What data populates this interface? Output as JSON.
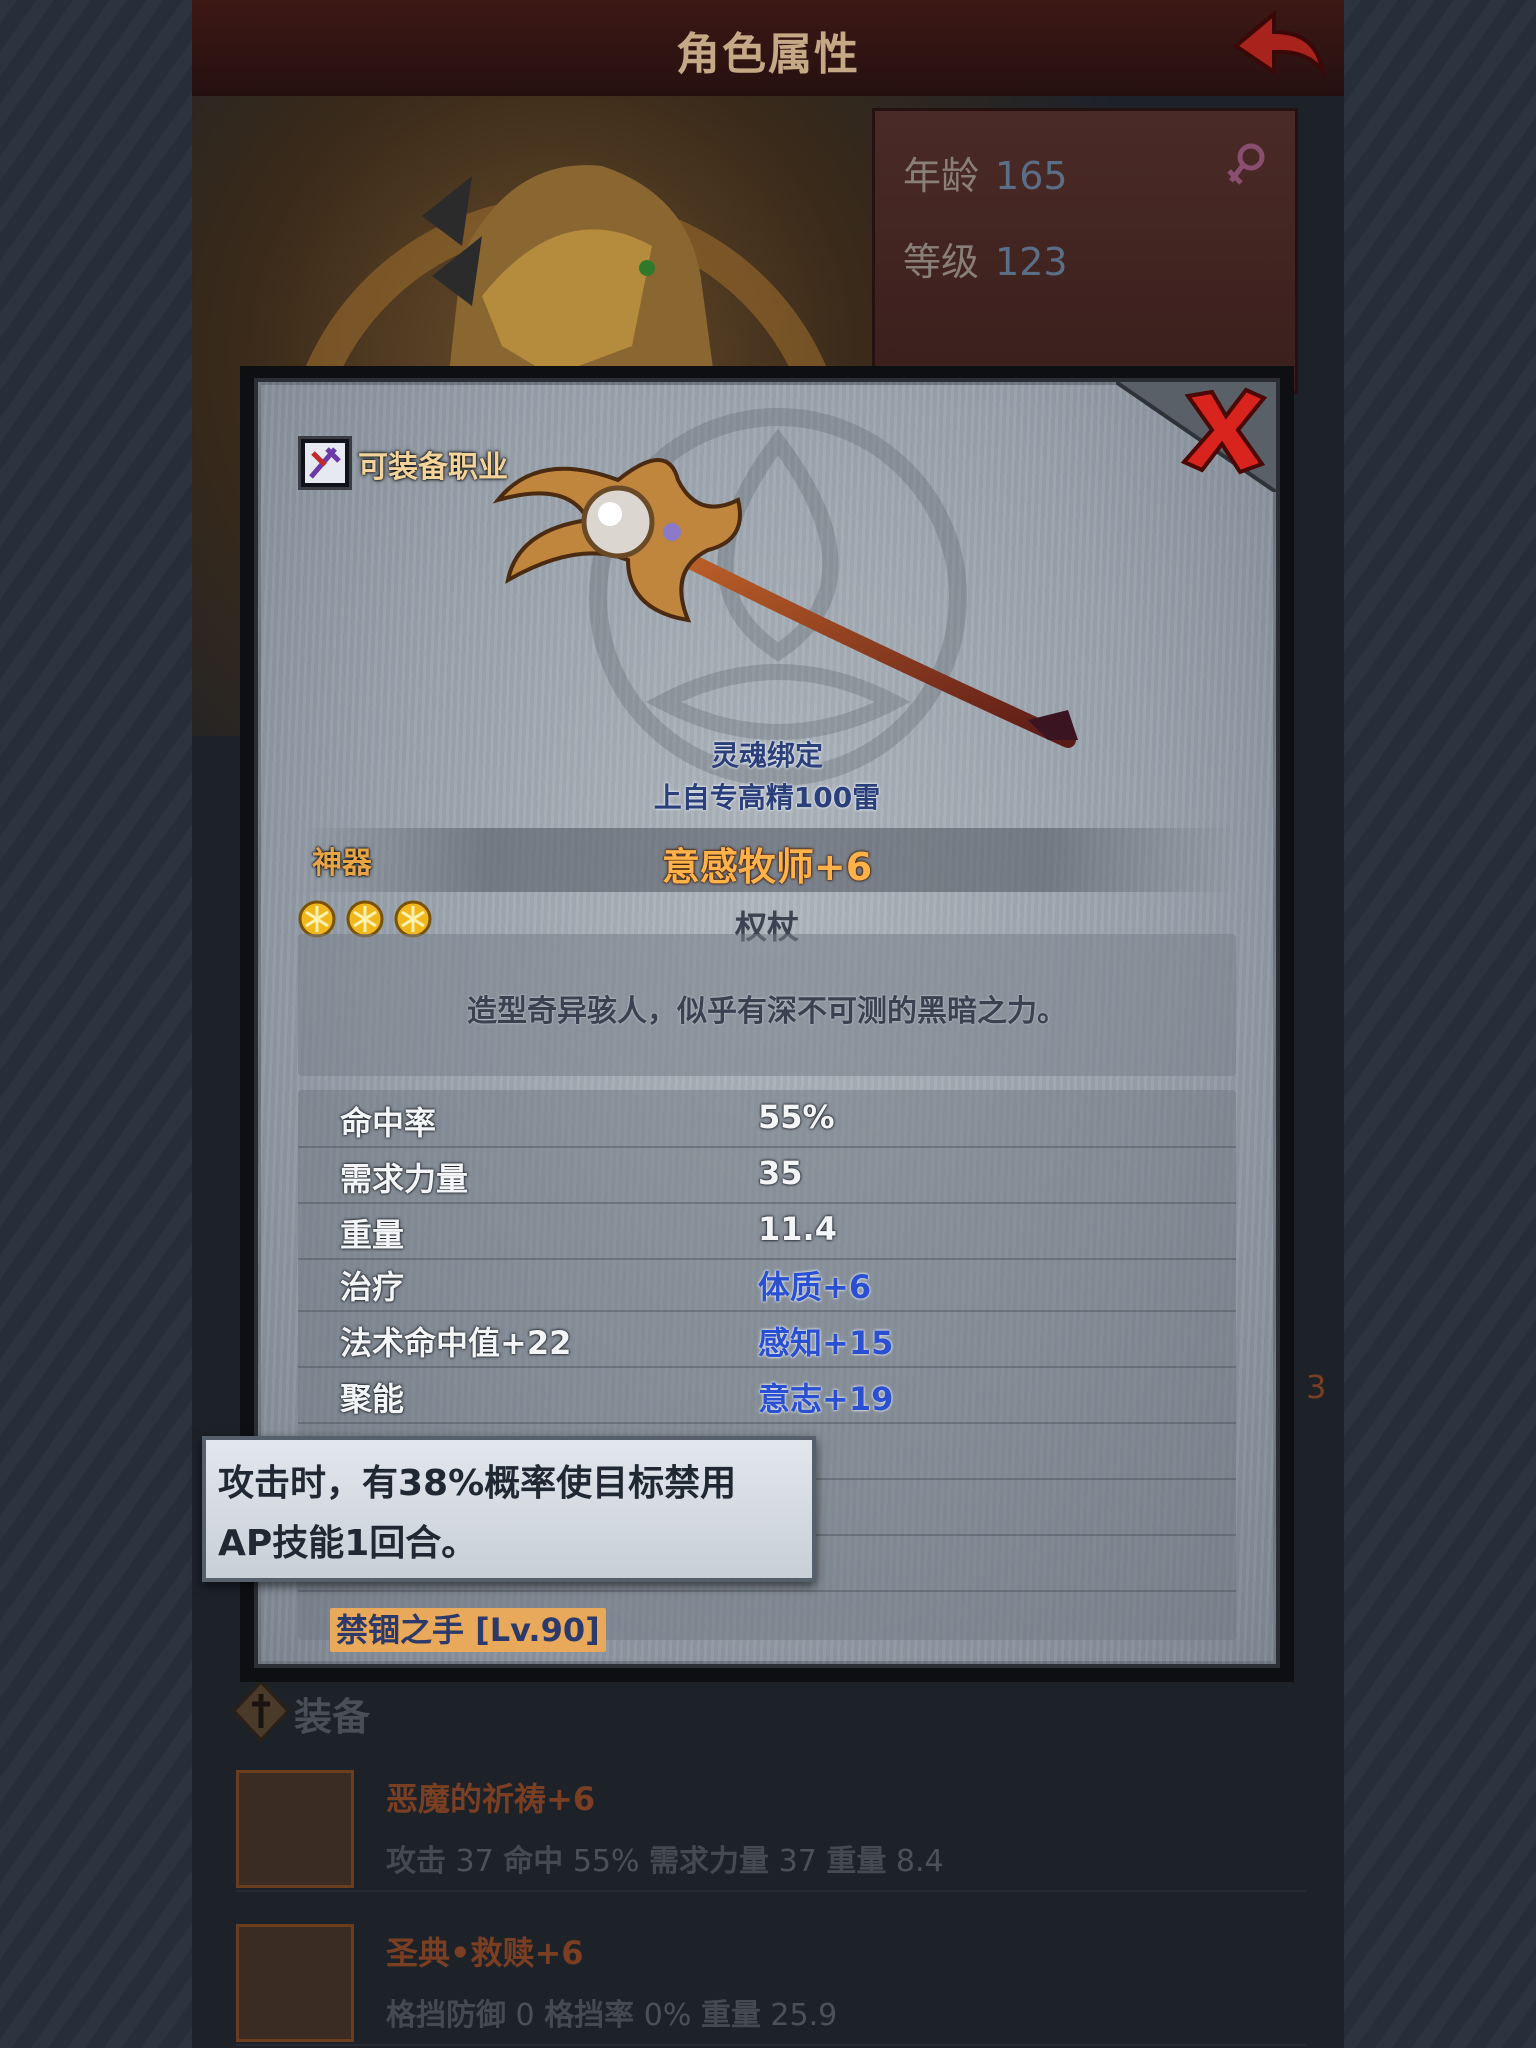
{
  "header": {
    "title": "角色属性"
  },
  "profile": {
    "age_label": "年龄",
    "age_value": "165",
    "level_label": "等级",
    "level_value": "123"
  },
  "equipment_section": {
    "title": "装备",
    "items": [
      {
        "name": "恶魔的祈祷+6",
        "stats": [
          {
            "k": "攻击",
            "v": "37"
          },
          {
            "k": "命中",
            "v": "55%"
          },
          {
            "k": "需求力量",
            "v": "37"
          },
          {
            "k": "重量",
            "v": "8.4"
          }
        ]
      },
      {
        "name": "圣典•救赎+6",
        "stats": [
          {
            "k": "格挡防御",
            "v": "0"
          },
          {
            "k": "格挡率",
            "v": "0%"
          },
          {
            "k": "重量",
            "v": "25.9"
          }
        ]
      }
    ]
  },
  "side_number": "3",
  "modal": {
    "equip_class_label": "可装备职业",
    "soulbound": "灵魂绑定",
    "crafter": "上自专高精100雷",
    "rarity": "神器",
    "item_name": "意感牧师+6",
    "item_type": "权杖",
    "stars": 3,
    "description": "造型奇异骇人，似乎有深不可测的黑暗之力。",
    "stats": [
      {
        "left": "命中率",
        "right": "55%",
        "right_blue": false
      },
      {
        "left": "需求力量",
        "right": "35",
        "right_blue": false
      },
      {
        "left": "重量",
        "right": "11.4",
        "right_blue": false
      },
      {
        "left": "治疗",
        "right": "体质+6",
        "right_blue": true
      },
      {
        "left": "法术命中值+22",
        "right": "感知+15",
        "right_blue": true
      },
      {
        "left": "聚能",
        "right": "意志+19",
        "right_blue": true
      }
    ],
    "skill": "禁锢之手 [Lv.90]"
  },
  "tooltip": {
    "line1": "攻击时，有38%概率使目标禁用",
    "line2": "AP技能1回合。"
  },
  "colors": {
    "accent_orange": "#ffb24a",
    "rarity_gold": "#e8a546",
    "stat_blue": "#2a4fd0",
    "close_red": "#d8241c"
  }
}
